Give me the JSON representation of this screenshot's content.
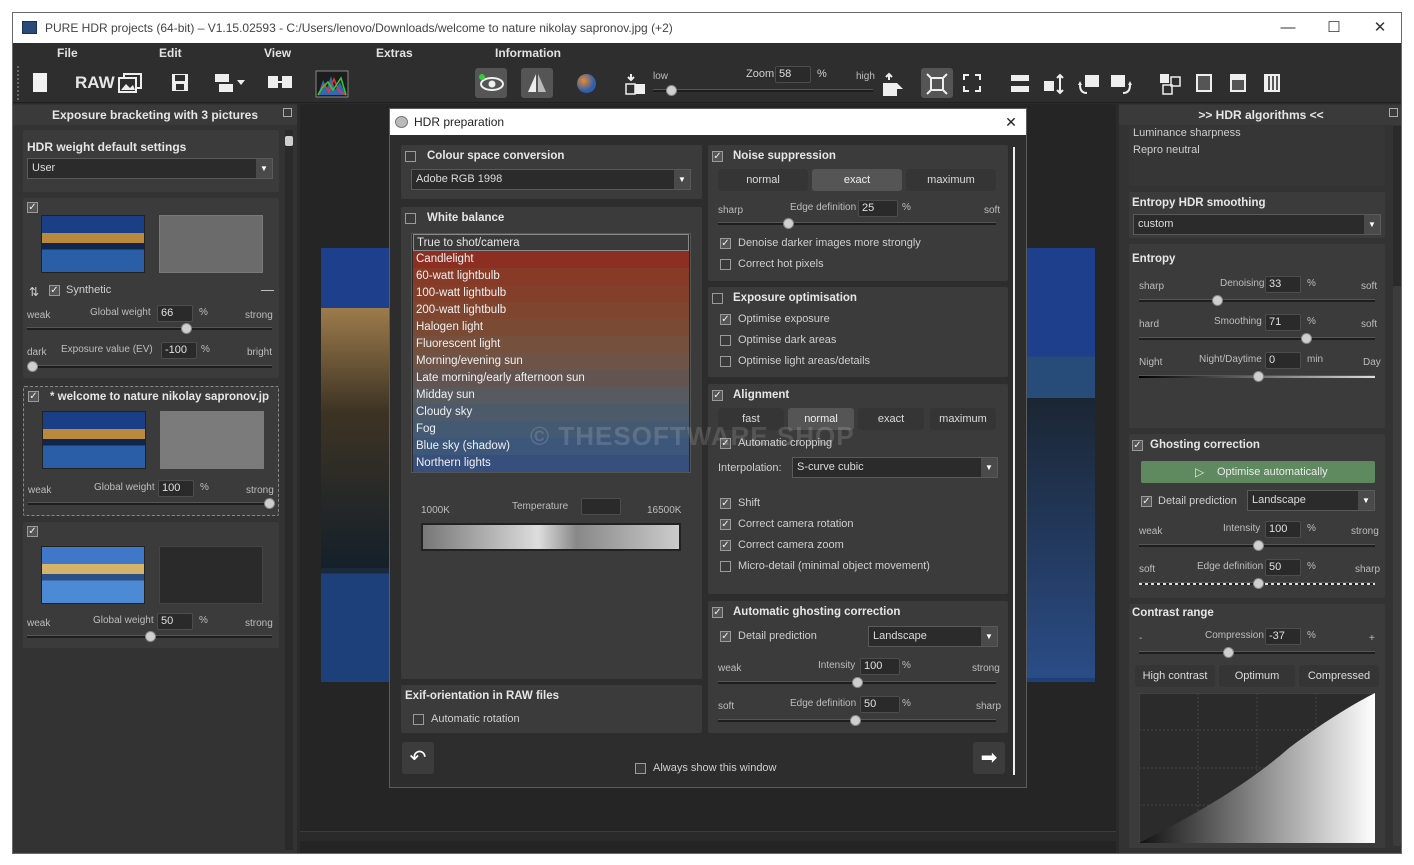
{
  "window": {
    "title": "PURE HDR projects (64-bit) – V1.15.02593 - C:/Users/lenovo/Downloads/welcome to nature nikolay sapronov.jpg (+2)",
    "minimize": "—",
    "maximize": "☐",
    "close": "✕"
  },
  "menu": {
    "file": "File",
    "edit": "Edit",
    "view": "View",
    "extras": "Extras",
    "information": "Information"
  },
  "toolbar": {
    "raw": "RAW",
    "zoom_low": "low",
    "zoom_label": "Zoom",
    "zoom_value": "58",
    "zoom_unit": "%",
    "zoom_high": "high"
  },
  "left_panel": {
    "header": "Exposure bracketing with 3 pictures",
    "hdr_weight_title": "HDR weight default settings",
    "hdr_weight_value": "User",
    "synthetic_label": "Synthetic",
    "global_weight_label": "Global weight",
    "exposure_label": "Exposure value (EV)",
    "weak": "weak",
    "strong": "strong",
    "dark": "dark",
    "bright": "bright",
    "percent": "%",
    "pictures": [
      {
        "global_weight": "66",
        "exposure": "-100",
        "weight_level": 0.6
      },
      {
        "name": "* welcome to nature nikolay sapronov.jp",
        "global_weight": "100",
        "weight_level": 1.0
      },
      {
        "global_weight": "50",
        "weight_level": 0.5
      }
    ]
  },
  "dialog": {
    "title": "HDR preparation",
    "close": "✕",
    "watermark": "© THESOFTWARE.SHOP",
    "colour_space": {
      "title": "Colour space conversion",
      "value": "Adobe RGB 1998"
    },
    "white_balance": {
      "title": "White balance",
      "items": [
        "True to shot/camera",
        "Candlelight",
        "60-watt lightbulb",
        "100-watt lightbulb",
        "200-watt lightbulb",
        "Halogen light",
        "Fluorescent light",
        "Morning/evening sun",
        "Late morning/early afternoon sun",
        "Midday sun",
        "Cloudy sky",
        "Fog",
        "Blue sky (shadow)",
        "Northern lights"
      ],
      "item_colors": [
        "#3a3a3a",
        "#8c2f22",
        "#873a26",
        "#833f2a",
        "#80452f",
        "#7a4a35",
        "#74503d",
        "#6d5447",
        "#625551",
        "#575a5f",
        "#4d5a6a",
        "#445a72",
        "#3d577a",
        "#374f7c"
      ],
      "temp_min": "1000K",
      "temp_label": "Temperature",
      "temp_max": "16500K"
    },
    "exif": {
      "title": "Exif-orientation in RAW files",
      "auto_rotation": "Automatic rotation"
    },
    "always_show": "Always show this window",
    "noise": {
      "title": "Noise suppression",
      "modes": [
        "normal",
        "exact",
        "maximum"
      ],
      "sharp": "sharp",
      "edge_label": "Edge definition",
      "edge_value": "25",
      "soft": "soft",
      "denoise_darker": "Denoise darker images more strongly",
      "hot_pixels": "Correct hot pixels"
    },
    "exposure_opt": {
      "title": "Exposure optimisation",
      "optimise_exposure": "Optimise exposure",
      "optimise_dark": "Optimise dark areas",
      "optimise_light": "Optimise light areas/details"
    },
    "alignment": {
      "title": "Alignment",
      "modes": [
        "fast",
        "normal",
        "exact",
        "maximum"
      ],
      "auto_crop": "Automatic cropping",
      "interp_label": "Interpolation:",
      "interp_value": "S-curve cubic",
      "shift": "Shift",
      "rotation": "Correct camera rotation",
      "zoom": "Correct camera zoom",
      "micro": "Micro-detail (minimal object movement)"
    },
    "ghosting": {
      "title": "Automatic ghosting correction",
      "detail_label": "Detail prediction",
      "detail_value": "Landscape",
      "weak": "weak",
      "intensity_label": "Intensity",
      "intensity_value": "100",
      "strong": "strong",
      "soft": "soft",
      "edge_label": "Edge definition",
      "edge_value": "50",
      "sharp": "sharp"
    },
    "percent": "%"
  },
  "right_panel": {
    "header": ">> HDR algorithms <<",
    "list_items": [
      "Luminance sharpness",
      "Repro neutral"
    ],
    "entropy_smoothing_title": "Entropy HDR smoothing",
    "entropy_smoothing_value": "custom",
    "entropy": {
      "title": "Entropy",
      "sharp": "sharp",
      "denoising_label": "Denoising",
      "denoising_value": "33",
      "soft": "soft",
      "hard": "hard",
      "smoothing_label": "Smoothing",
      "smoothing_value": "71",
      "night": "Night",
      "nightday_label": "Night/Daytime",
      "nightday_value": "0",
      "min_unit": "min",
      "day": "Day",
      "percent": "%"
    },
    "ghosting": {
      "title": "Ghosting correction",
      "optimise": "Optimise automatically",
      "detail_label": "Detail prediction",
      "detail_value": "Landscape",
      "weak": "weak",
      "intensity_label": "Intensity",
      "intensity_value": "100",
      "strong": "strong",
      "soft": "soft",
      "edge_label": "Edge definition",
      "edge_value": "50",
      "sharp": "sharp",
      "percent": "%"
    },
    "contrast": {
      "title": "Contrast range",
      "minus": "-",
      "compression_label": "Compression",
      "compression_value": "-37",
      "plus": "+",
      "percent": "%",
      "modes": [
        "High contrast",
        "Optimum",
        "Compressed"
      ]
    }
  }
}
